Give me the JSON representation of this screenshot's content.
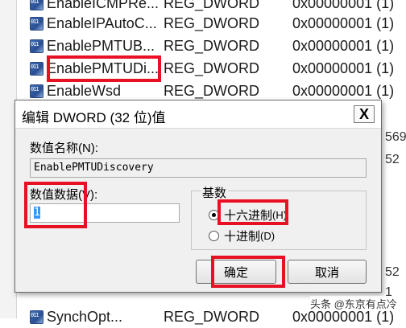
{
  "registry": {
    "rows": [
      {
        "name": "EnableICMPRe...",
        "type": "REG_DWORD",
        "data": "0x00000001 (1)"
      },
      {
        "name": "EnableIPAutoC...",
        "type": "REG_DWORD",
        "data": "0x00000001 (1)"
      },
      {
        "name": "EnablePMTUB...",
        "type": "REG_DWORD",
        "data": "0x00000001 (1)"
      },
      {
        "name": "EnablePMTUDi...",
        "type": "REG_DWORD",
        "data": "0x00000001 (1)"
      },
      {
        "name": "EnableWsd",
        "type": "REG_DWORD",
        "data": "0x00000001 (1)"
      },
      {
        "name": "SynchOpt...",
        "type": "REG_DWORD",
        "data": "0x00000001 (1)"
      }
    ],
    "right_fragments": [
      "569",
      "52",
      "52",
      "1"
    ]
  },
  "dialog": {
    "title": "编辑 DWORD (32 位)值",
    "close_label": "X",
    "value_name_label": "数值名称(N):",
    "value_name": "EnablePMTUDiscovery",
    "value_data_label": "数值数据(V):",
    "value_data": "1",
    "base_label": "基数",
    "base_options": [
      {
        "label": "十六进制",
        "shortcut": "(H)",
        "checked": true
      },
      {
        "label": "十进制",
        "shortcut": "(D)",
        "checked": false
      }
    ],
    "ok_label": "确定",
    "cancel_label": "取消"
  },
  "watermark": "头条 @东京有点冷",
  "colors": {
    "highlight": "#e81123",
    "dialog_bg": "#f0f0f0"
  }
}
